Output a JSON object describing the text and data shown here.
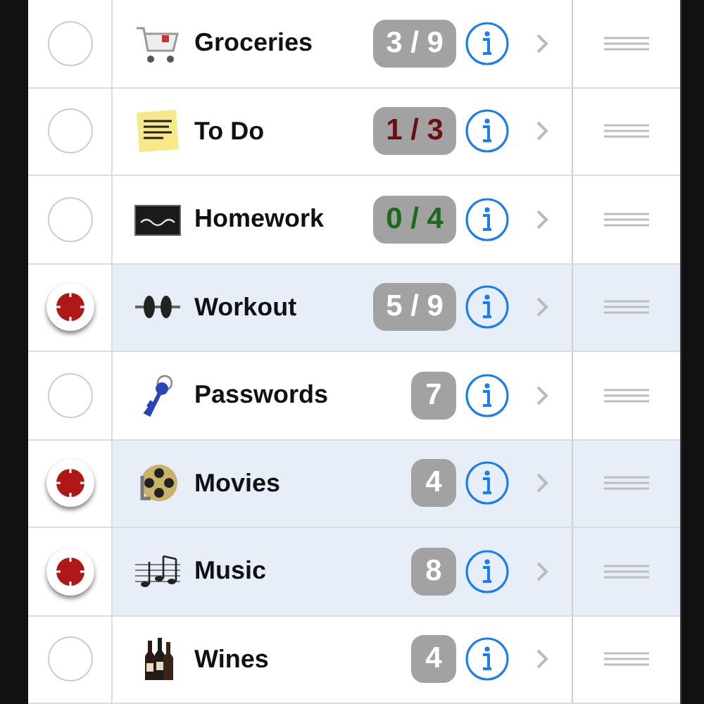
{
  "lists": [
    {
      "name": "Groceries",
      "badge": "3 / 9",
      "kind": "plain",
      "selected": false
    },
    {
      "name": "To Do",
      "badge": "1 / 3",
      "kind": "overdue",
      "selected": false
    },
    {
      "name": "Homework",
      "badge": "0 / 4",
      "kind": "done",
      "selected": false
    },
    {
      "name": "Workout",
      "badge": "5 / 9",
      "kind": "plain",
      "selected": true
    },
    {
      "name": "Passwords",
      "badge": "7",
      "kind": "plain",
      "selected": false
    },
    {
      "name": "Movies",
      "badge": "4",
      "kind": "plain",
      "selected": true
    },
    {
      "name": "Music",
      "badge": "8",
      "kind": "plain",
      "selected": true
    },
    {
      "name": "Wines",
      "badge": "4",
      "kind": "plain",
      "selected": false
    }
  ]
}
